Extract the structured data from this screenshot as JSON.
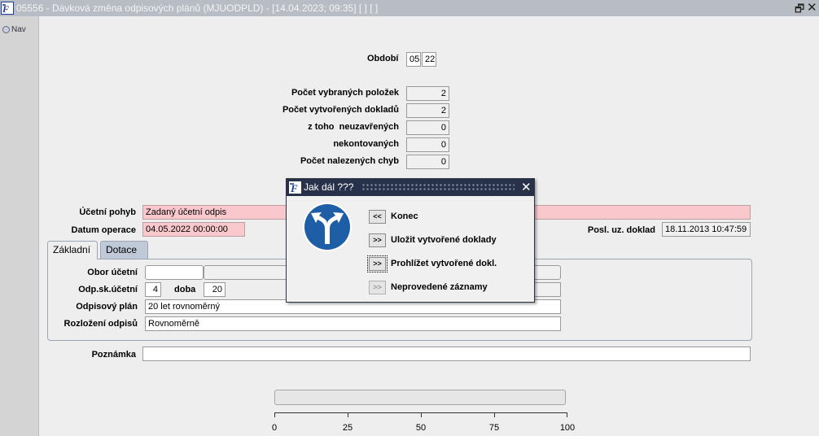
{
  "window": {
    "title": "05556 - Dávková změna odpisových plánů (MJUODPLD) - [14.04.2023; 09:35] [ ] [ ]",
    "restore_glyph": "🗗",
    "close_glyph": "✕"
  },
  "nav": {
    "label": "Nav"
  },
  "period": {
    "label": "Období",
    "month": "05",
    "year": "22"
  },
  "counts": [
    {
      "label": "Počet vybraných položek",
      "value": "2"
    },
    {
      "label": "Počet vytvořených dokladů",
      "value": "2"
    },
    {
      "label": "z toho  neuzavřených",
      "value": "0"
    },
    {
      "label": "nekontovaných",
      "value": "0"
    },
    {
      "label": "Počet nalezených chyb",
      "value": "0"
    }
  ],
  "movement": {
    "label": "Účetní pohyb",
    "value": "Zadaný účetní odpis"
  },
  "operation_date": {
    "label": "Datum operace",
    "value": "04.05.2022 00:00:00"
  },
  "last_doc": {
    "label": "Posl. uz. doklad",
    "value": "18.11.2013 10:47:59"
  },
  "tabs": [
    {
      "label": "Základní"
    },
    {
      "label": "Dotace"
    }
  ],
  "form": {
    "obor_label": "Obor účetní",
    "obor_value": "",
    "odp_label": "Odp.sk.účetní",
    "odp_value": "4",
    "doba_label": "doba",
    "doba_value": "20",
    "plan_label": "Odpisový plán",
    "plan_value": "20 let rovnoměrný",
    "rozlozeni_label": "Rozložení odpisů",
    "rozlozeni_value": "Rovnoměrně"
  },
  "note": {
    "label": "Poznámka",
    "value": ""
  },
  "progress": {
    "value_percent": 0,
    "ticks": [
      "0",
      "25",
      "50",
      "75",
      "100"
    ]
  },
  "dialog": {
    "title": "Jak dál ???",
    "close_glyph": "✕",
    "icon": "fork-road-sign-icon",
    "options": [
      {
        "button": "<<",
        "label": "Konec"
      },
      {
        "button": ">>",
        "label": "Uložit vytvořené doklady"
      },
      {
        "button": ">>",
        "label": "Prohlížet vytvořené dokl."
      },
      {
        "button": ">>",
        "label": "Neprovedené záznamy"
      }
    ]
  },
  "colors": {
    "titlebar": "#b8bcc4",
    "dialog_titlebar": "#27314a",
    "required_field": "#f8c8cc",
    "sign_blue": "#1d5ea6"
  }
}
